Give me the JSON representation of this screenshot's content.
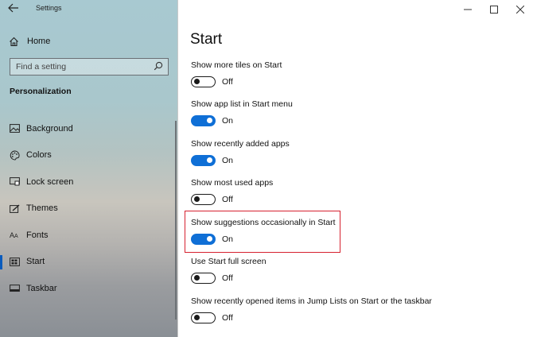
{
  "window": {
    "title": "Settings",
    "back_icon": "arrow-left-icon",
    "controls": {
      "minimize": "—",
      "maximize": "☐",
      "close": "✕"
    }
  },
  "sidebar": {
    "home_label": "Home",
    "search_placeholder": "Find a setting",
    "section_heading": "Personalization",
    "items": [
      {
        "label": "Background",
        "icon": "picture-icon"
      },
      {
        "label": "Colors",
        "icon": "palette-icon"
      },
      {
        "label": "Lock screen",
        "icon": "lock-screen-icon"
      },
      {
        "label": "Themes",
        "icon": "brush-icon"
      },
      {
        "label": "Fonts",
        "icon": "font-icon"
      },
      {
        "label": "Start",
        "icon": "start-icon",
        "active": true
      },
      {
        "label": "Taskbar",
        "icon": "taskbar-icon"
      }
    ]
  },
  "main": {
    "title": "Start",
    "settings": [
      {
        "label": "Show more tiles on Start",
        "state": "Off"
      },
      {
        "label": "Show app list in Start menu",
        "state": "On"
      },
      {
        "label": "Show recently added apps",
        "state": "On"
      },
      {
        "label": "Show most used apps",
        "state": "Off"
      },
      {
        "label": "Show suggestions occasionally in Start",
        "state": "On"
      },
      {
        "label": "Use Start full screen",
        "state": "Off"
      },
      {
        "label": "Show recently opened items in Jump Lists on Start or the taskbar",
        "state": "Off"
      }
    ]
  },
  "colors": {
    "accent": "#0f6fd6",
    "highlight": "#d6212f"
  }
}
